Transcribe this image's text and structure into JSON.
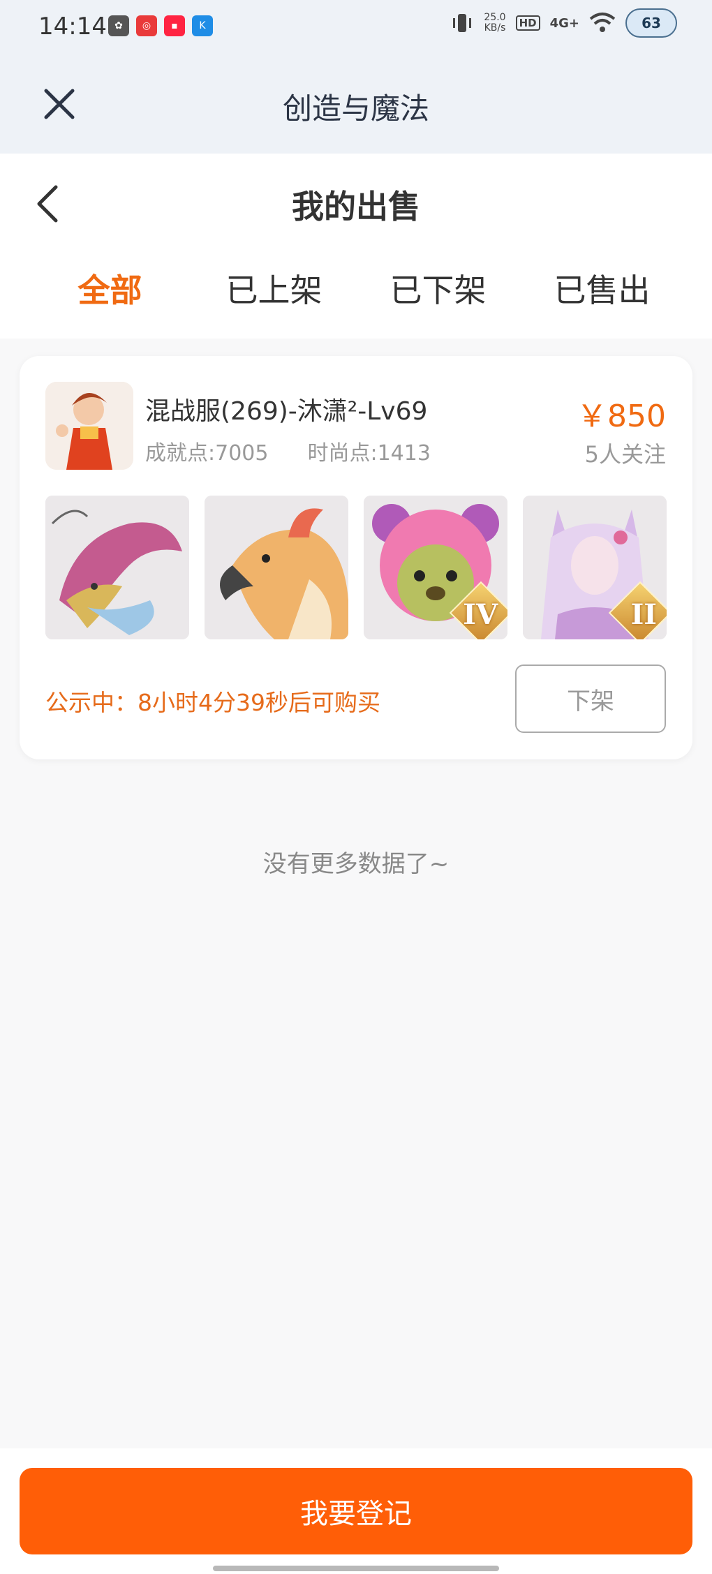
{
  "status_bar": {
    "time": "14:14",
    "net_speed_value": "25.0",
    "net_speed_unit": "KB/s",
    "hd": "HD",
    "signal": "4G+",
    "battery": "63"
  },
  "app_bar": {
    "title": "创造与魔法"
  },
  "header": {
    "title": "我的出售",
    "tabs": [
      {
        "label": "全部",
        "active": true
      },
      {
        "label": "已上架",
        "active": false
      },
      {
        "label": "已下架",
        "active": false
      },
      {
        "label": "已售出",
        "active": false
      }
    ]
  },
  "listing": {
    "name": "混战服(269)-沐潇²-Lv69",
    "achievement": "成就点:7005",
    "fashion": "时尚点:1413",
    "price": "￥850",
    "followers": "5人关注",
    "items": [
      {
        "icon": "dragon-mount-icon",
        "rank": ""
      },
      {
        "icon": "phoenix-mount-icon",
        "rank": ""
      },
      {
        "icon": "pink-bear-pet-icon",
        "rank": "IV"
      },
      {
        "icon": "fox-fairy-costume-icon",
        "rank": "II"
      }
    ],
    "notice": "公示中：8小时4分39秒后可购买",
    "offshelf_label": "下架"
  },
  "list_end_text": "没有更多数据了~",
  "bottom": {
    "register_label": "我要登记"
  },
  "colors": {
    "accent": "#f06a12",
    "button": "#ff5e07"
  }
}
